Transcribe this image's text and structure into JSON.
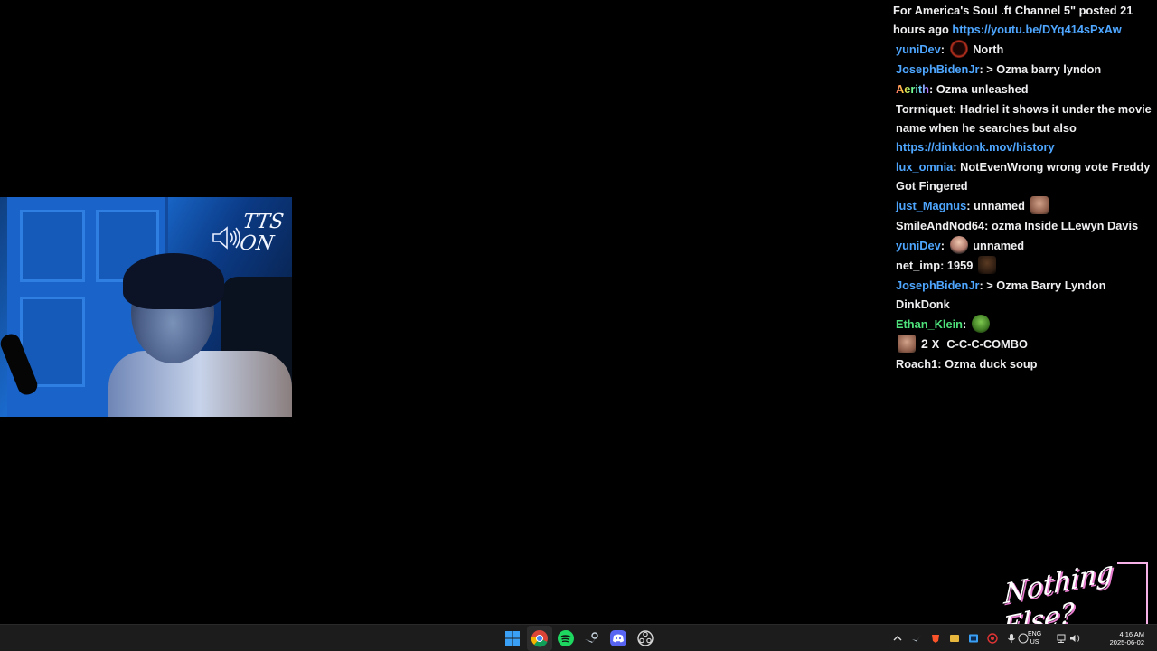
{
  "webcam": {
    "tts_badge": "TTS ON"
  },
  "chat": {
    "messages": [
      {
        "text": "For America's Soul .ft Channel 5\" posted 21 hours ago",
        "link": "https://youtu.be/DYq414sPxAw"
      },
      {
        "user": "yuniDev",
        "user_color": "#4ea6ff",
        "sep": ":",
        "emote": "dark-ring-emote",
        "text": "North"
      },
      {
        "user": "JosephBidenJr",
        "user_color": "#4ea6ff",
        "sep": ":",
        "text": "> Ozma barry lyndon"
      },
      {
        "user": "Aerith",
        "user_color": "rainbow",
        "sep": ":",
        "text": "Ozma unleashed"
      },
      {
        "user": "Torrniquet",
        "user_color": "#efeff1",
        "sep": ":",
        "text": "Hadriel it shows it under the movie name when he searches but also",
        "link": "https://dinkdonk.mov/history"
      },
      {
        "user": "lux_omnia",
        "user_color": "#4ea6ff",
        "sep": ":",
        "text": "NotEvenWrong wrong vote Freddy Got Fingered"
      },
      {
        "user": "just_Magnus",
        "user_color": "#4ea6ff",
        "sep": ":",
        "text": "unnamed",
        "trailing_emote": "face-emote"
      },
      {
        "user": "SmileAndNod64",
        "user_color": "#efeff1",
        "sep": ":",
        "text": "ozma Inside LLewyn Davis"
      },
      {
        "user": "yuniDev",
        "user_color": "#4ea6ff",
        "sep": ":",
        "emote": "person-emote",
        "text": "unnamed"
      },
      {
        "user": "net_imp",
        "user_color": "#efeff1",
        "sep": ":",
        "text": "1959",
        "trailing_emote": "dancer-emote"
      },
      {
        "user": "JosephBidenJr",
        "user_color": "#4ea6ff",
        "sep": ":",
        "text": "> Ozma Barry Lyndon DinkDonk"
      },
      {
        "user": "Ethan_Klein",
        "user_color": "#4ee07a",
        "sep": ":",
        "emote": "walking-emote",
        "text": ""
      },
      {
        "combo": true,
        "emote": "face-emote",
        "count": "2",
        "x": "X",
        "text": "C-C-C-COMBO"
      },
      {
        "user": "Roach1",
        "user_color": "#efeff1",
        "sep": ":",
        "text": "Ozma duck soup"
      }
    ]
  },
  "overlay_logo": {
    "text": "Nothing Else?"
  },
  "taskbar": {
    "apps": [
      "windows-start-icon",
      "chrome-icon",
      "spotify-icon",
      "steam-icon",
      "discord-icon",
      "obs-icon"
    ],
    "tray": {
      "lang_top": "ENG",
      "lang_bottom": "US",
      "time": "4:16 AM",
      "date": "2025-06-02"
    }
  }
}
